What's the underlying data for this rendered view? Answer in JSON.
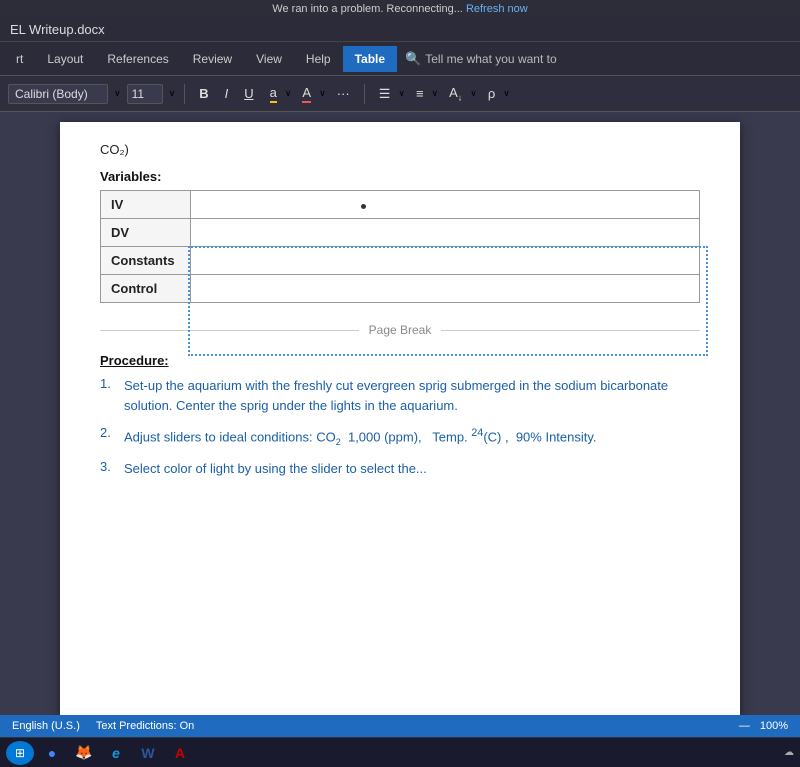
{
  "topNotice": {
    "text": "We ran into a problem. Reconnecting...",
    "linkText": "Refresh now"
  },
  "titleBar": {
    "filename": "EL Writeup.docx"
  },
  "ribbonTabs": {
    "items": [
      {
        "label": "rt",
        "active": false
      },
      {
        "label": "Layout",
        "active": false
      },
      {
        "label": "References",
        "active": false
      },
      {
        "label": "Review",
        "active": false
      },
      {
        "label": "View",
        "active": false
      },
      {
        "label": "Help",
        "active": false
      },
      {
        "label": "Table",
        "active": true
      }
    ],
    "searchPlaceholder": "Tell me what you want to"
  },
  "formatToolbar": {
    "fontName": "Calibri (Body)",
    "fontSize": "11",
    "buttons": {
      "bold": "B",
      "italic": "I",
      "underline": "U",
      "highlight": "a",
      "fontColor": "A",
      "ellipsis": "···"
    }
  },
  "documentContent": {
    "co2Header": "CO₂)",
    "variablesLabel": "Variables:",
    "tableRows": [
      {
        "label": "IV",
        "value": ""
      },
      {
        "label": "DV",
        "value": ""
      },
      {
        "label": "Constants",
        "value": ""
      },
      {
        "label": "Control",
        "value": ""
      }
    ],
    "pageBreakLabel": "Page Break",
    "procedureLabel": "Procedure:",
    "procedureItems": [
      {
        "num": "1.",
        "text": "Set-up the aquarium with the freshly cut evergreen sprig submerged in the sodium bicarbonate solution. Center the sprig under the lights in the aquarium."
      },
      {
        "num": "2.",
        "text": "Adjust sliders to ideal conditions: CO₂  1,000 (ppm),   Temp. 24(C) ,  90% Intensity."
      },
      {
        "num": "3.",
        "text": "Select color of light by using the slider to select the..."
      }
    ]
  },
  "statusBar": {
    "language": "English (U.S.)",
    "predictions": "Text Predictions: On",
    "zoom": "100%",
    "dashLabel": "—"
  },
  "taskbar": {
    "startLabel": "⊞",
    "icons": [
      {
        "name": "chrome-icon",
        "symbol": "●",
        "color": "#4285f4"
      },
      {
        "name": "firefox-icon",
        "symbol": "🦊"
      },
      {
        "name": "edge-icon",
        "symbol": "e"
      },
      {
        "name": "word-icon",
        "symbol": "W"
      },
      {
        "name": "pdf-icon",
        "symbol": "A"
      }
    ]
  }
}
